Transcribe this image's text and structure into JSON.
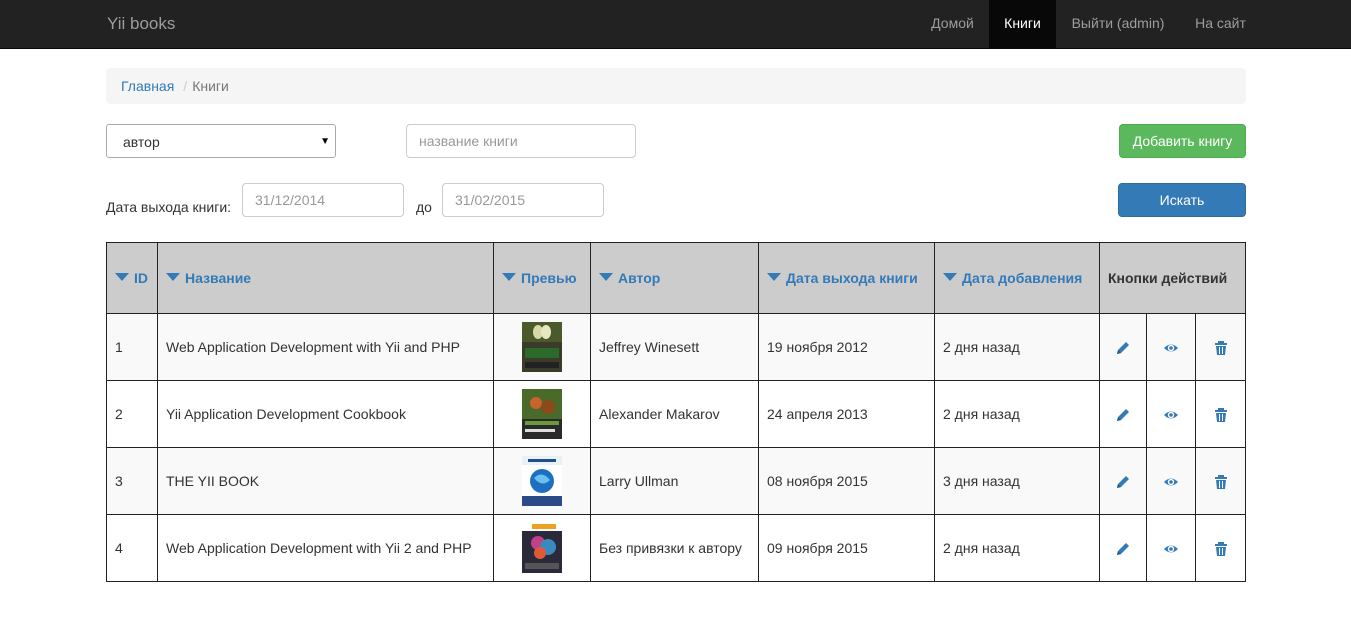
{
  "nav": {
    "brand": "Yii books",
    "items": [
      {
        "label": "Домой"
      },
      {
        "label": "Книги"
      },
      {
        "label": "Выйти (admin)"
      },
      {
        "label": "На сайт"
      }
    ]
  },
  "breadcrumb": {
    "home": "Главная",
    "separator": "/",
    "current": "Книги"
  },
  "filters": {
    "author_select": {
      "value": "автор",
      "arrow": "▼"
    },
    "title_input": {
      "placeholder": "название книги"
    },
    "date_label": "Дата выхода книги:",
    "date_from": "31/12/2014",
    "to_label": "до",
    "date_to": "31/02/2015"
  },
  "buttons": {
    "add": "Добавить книгу",
    "search": "Искать"
  },
  "table": {
    "headers": {
      "id": "ID",
      "title": "Название",
      "preview": "Превью",
      "author": "Автор",
      "release_date": "Дата выхода книги",
      "added": "Дата добавления",
      "actions": "Кнопки действий"
    },
    "rows": [
      {
        "id": "1",
        "title": "Web Application Development with Yii and PHP",
        "author": "Jeffrey Winesett",
        "release_date": "19 ноября 2012",
        "added": "2 дня назад"
      },
      {
        "id": "2",
        "title": "Yii Application Development Cookbook",
        "author": "Alexander Makarov",
        "release_date": "24 апреля 2013",
        "added": "2 дня назад"
      },
      {
        "id": "3",
        "title": "THE YII BOOK",
        "author": "Larry Ullman",
        "release_date": "08 ноября 2015",
        "added": "3 дня назад"
      },
      {
        "id": "4",
        "title": "Web Application Development with Yii 2 and PHP",
        "author": "Без привязки к автору",
        "release_date": "09 ноября 2015",
        "added": "2 дня назад"
      }
    ]
  },
  "icons": {
    "edit": "pencil-icon",
    "view": "eye-icon",
    "delete": "trash-icon"
  },
  "colors": {
    "navbar": "#222222",
    "link": "#337ab7",
    "success": "#5cb85c",
    "primary": "#337ab7",
    "header_bg": "#cccccc"
  }
}
